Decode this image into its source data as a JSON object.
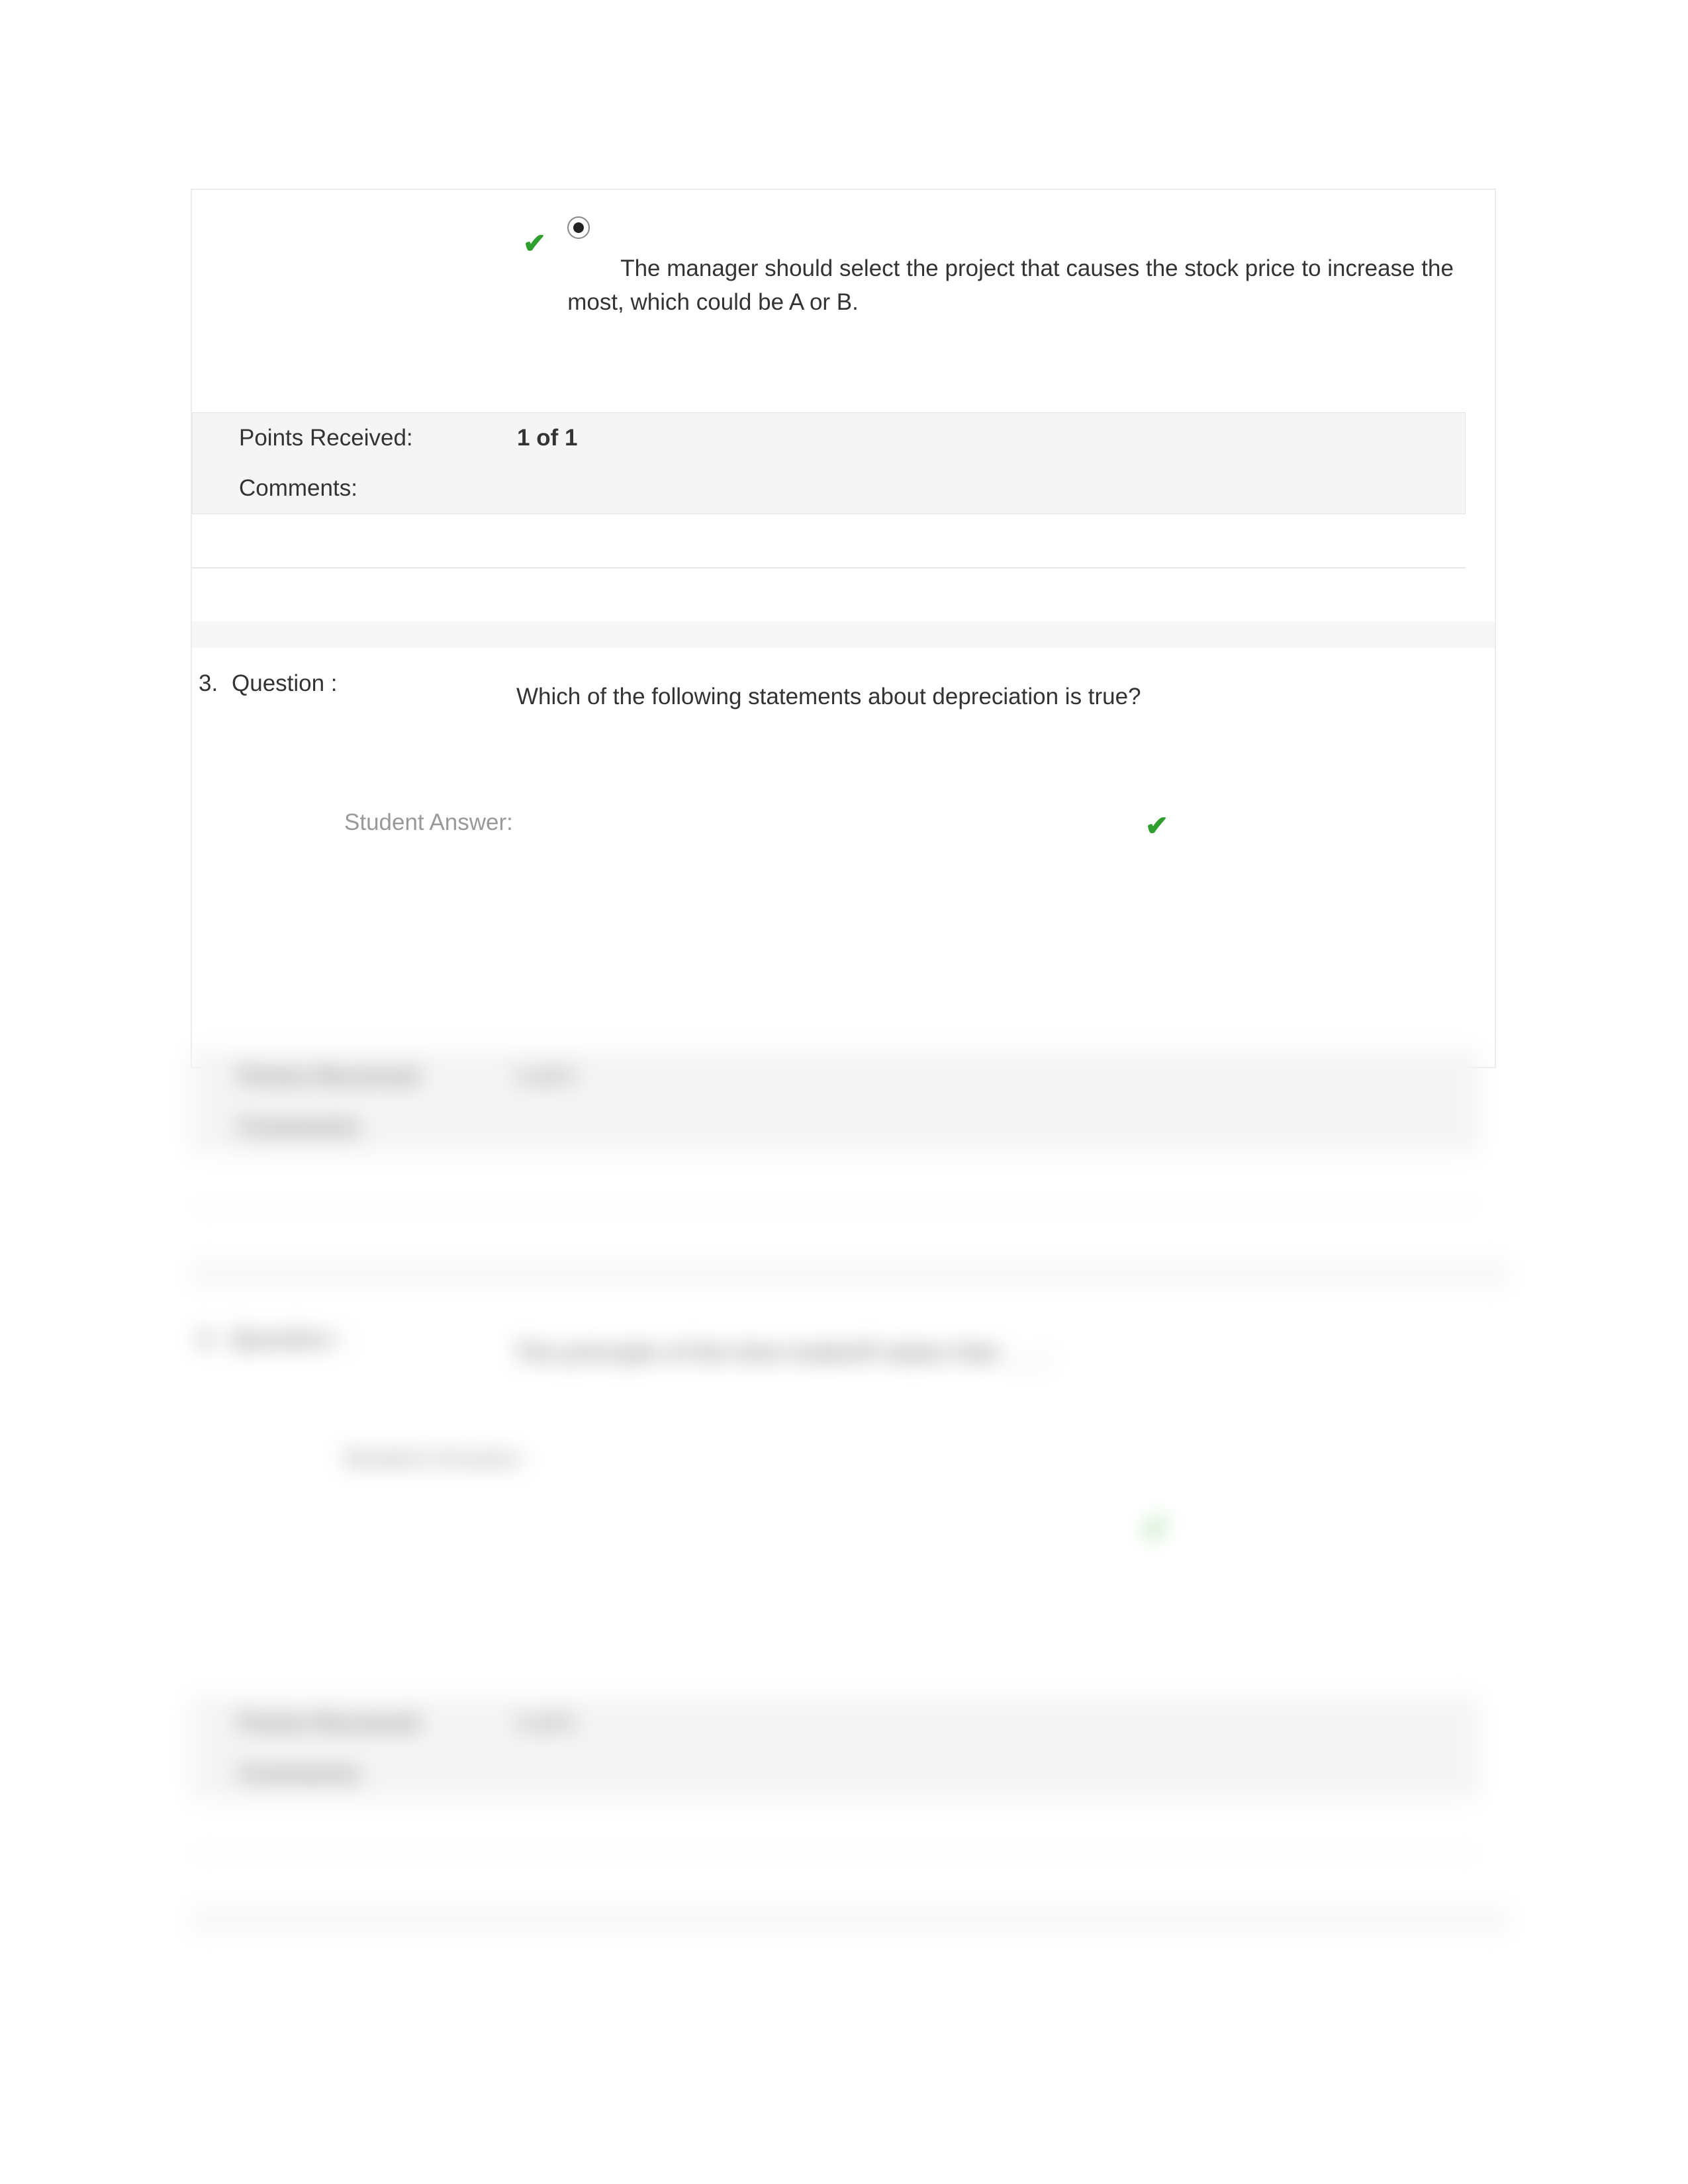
{
  "q2": {
    "answer_text": "The manager should select the project that causes the stock price to increase the most, which could be A or B.",
    "points_received_label": "Points Received:",
    "points_received_value": "1 of 1",
    "comments_label": "Comments:"
  },
  "q3": {
    "number": "3.",
    "question_label": "Question :",
    "question_text": "Which of the following statements about depreciation is true?",
    "student_answer_label": "Student Answer:"
  },
  "blur": {
    "points_received_label": "Points Received:",
    "points_value": "1 of 1",
    "comments_label": "Comments:",
    "q4_number": "4.",
    "q4_label": "Question :",
    "q4_text": "The principle of the time tradeoff states that ___.",
    "student_answer_label": "Student Answer:"
  }
}
